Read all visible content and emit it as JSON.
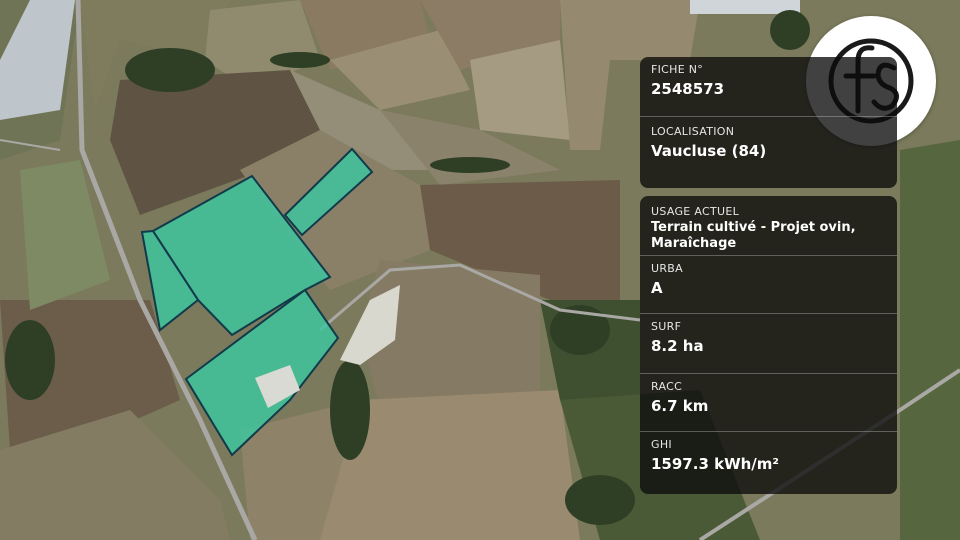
{
  "map": {
    "colors": {
      "parcel_fill": "#3cc7a0",
      "parcel_stroke": "#113a4a",
      "field_base": "#7d7a5f",
      "road": "#9a9a98"
    }
  },
  "logo": {
    "text": "fs"
  },
  "panel": {
    "fiche": {
      "label": "FICHE N°",
      "value": "2548573"
    },
    "localisation": {
      "label": "LOCALISATION",
      "value": "Vaucluse (84)"
    },
    "usage": {
      "label": "USAGE ACTUEL",
      "line1": "Terrain cultivé - Projet ovin,",
      "line2": "Maraîchage"
    },
    "urba": {
      "label": "URBA",
      "value": "A"
    },
    "surf": {
      "label": "SURF",
      "value": "8.2 ha"
    },
    "racc": {
      "label": "RACC",
      "value": "6.7 km"
    },
    "ghi": {
      "label": "GHI",
      "value": "1597.3 kWh/m²"
    }
  }
}
